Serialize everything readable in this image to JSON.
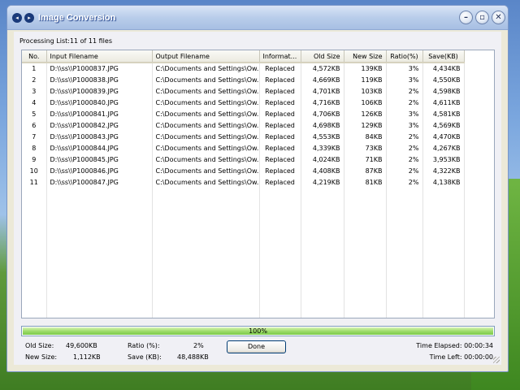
{
  "window": {
    "title": "Image Conversion"
  },
  "processing_label": "Processing List:11 of 11 files",
  "table": {
    "columns": [
      "No.",
      "Input Filename",
      "Output Filename",
      "Informat...",
      "Old Size",
      "New Size",
      "Ratio(%)",
      "Save(KB)"
    ],
    "rows": [
      [
        "1",
        "D:\\\\ss\\\\P1000837.JPG",
        "C:\\Documents and Settings\\Ow...",
        "Replaced",
        "4,572KB",
        "139KB",
        "3%",
        "4,434KB"
      ],
      [
        "2",
        "D:\\\\ss\\\\P1000838.JPG",
        "C:\\Documents and Settings\\Ow...",
        "Replaced",
        "4,669KB",
        "119KB",
        "3%",
        "4,550KB"
      ],
      [
        "3",
        "D:\\\\ss\\\\P1000839.JPG",
        "C:\\Documents and Settings\\Ow...",
        "Replaced",
        "4,701KB",
        "103KB",
        "2%",
        "4,598KB"
      ],
      [
        "4",
        "D:\\\\ss\\\\P1000840.JPG",
        "C:\\Documents and Settings\\Ow...",
        "Replaced",
        "4,716KB",
        "106KB",
        "2%",
        "4,611KB"
      ],
      [
        "5",
        "D:\\\\ss\\\\P1000841.JPG",
        "C:\\Documents and Settings\\Ow...",
        "Replaced",
        "4,706KB",
        "126KB",
        "3%",
        "4,581KB"
      ],
      [
        "6",
        "D:\\\\ss\\\\P1000842.JPG",
        "C:\\Documents and Settings\\Ow...",
        "Replaced",
        "4,698KB",
        "129KB",
        "3%",
        "4,569KB"
      ],
      [
        "7",
        "D:\\\\ss\\\\P1000843.JPG",
        "C:\\Documents and Settings\\Ow...",
        "Replaced",
        "4,553KB",
        "84KB",
        "2%",
        "4,470KB"
      ],
      [
        "8",
        "D:\\\\ss\\\\P1000844.JPG",
        "C:\\Documents and Settings\\Ow...",
        "Replaced",
        "4,339KB",
        "73KB",
        "2%",
        "4,267KB"
      ],
      [
        "9",
        "D:\\\\ss\\\\P1000845.JPG",
        "C:\\Documents and Settings\\Ow...",
        "Replaced",
        "4,024KB",
        "71KB",
        "2%",
        "3,953KB"
      ],
      [
        "10",
        "D:\\\\ss\\\\P1000846.JPG",
        "C:\\Documents and Settings\\Ow...",
        "Replaced",
        "4,408KB",
        "87KB",
        "2%",
        "4,322KB"
      ],
      [
        "11",
        "D:\\\\ss\\\\P1000847.JPG",
        "C:\\Documents and Settings\\Ow...",
        "Replaced",
        "4,219KB",
        "81KB",
        "2%",
        "4,138KB"
      ]
    ]
  },
  "progress": {
    "label": "100%",
    "percent": 100
  },
  "stats": {
    "old_size_label": "Old Size:",
    "old_size_value": "49,600KB",
    "new_size_label": "New Size:",
    "new_size_value": "1,112KB",
    "ratio_label": "Ratio (%):",
    "ratio_value": "2%",
    "save_label": "Save (KB):",
    "save_value": "48,488KB",
    "time_elapsed": "Time Elapsed: 00:00:34",
    "time_left": "Time Left: 00:00:00"
  },
  "done_button": "Done",
  "icons": {
    "back": "back-icon",
    "forward": "forward-icon",
    "minimize": "minimize-icon",
    "maximize": "maximize-icon",
    "close": "close-icon"
  }
}
